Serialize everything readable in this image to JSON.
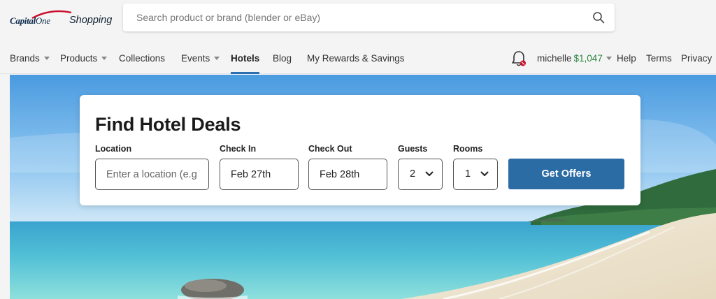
{
  "logo": {
    "brand_word": "Capital",
    "brand_one": "One",
    "product": "Shopping"
  },
  "search": {
    "placeholder": "Search product or brand (blender or eBay)",
    "icon": "search-icon"
  },
  "nav": {
    "items": [
      {
        "label": "Brands",
        "dropdown": true
      },
      {
        "label": "Products",
        "dropdown": true
      },
      {
        "label": "Collections",
        "dropdown": false
      },
      {
        "label": "Events",
        "dropdown": true
      },
      {
        "label": "Hotels",
        "dropdown": false,
        "active": true
      },
      {
        "label": "Blog",
        "dropdown": false
      },
      {
        "label": "My Rewards & Savings",
        "dropdown": false
      }
    ],
    "right": {
      "notification_icon": "bell-icon",
      "username": "michelle",
      "balance": "$1,047",
      "links": [
        "Help",
        "Terms",
        "Privacy"
      ]
    }
  },
  "hotel_form": {
    "title": "Find Hotel Deals",
    "location": {
      "label": "Location",
      "placeholder": "Enter a location (e.g"
    },
    "check_in": {
      "label": "Check In",
      "value": "Feb 27th"
    },
    "check_out": {
      "label": "Check Out",
      "value": "Feb 28th"
    },
    "guests": {
      "label": "Guests",
      "value": "2"
    },
    "rooms": {
      "label": "Rooms",
      "value": "1"
    },
    "submit_label": "Get Offers"
  },
  "colors": {
    "accent": "#2b6ca4",
    "balance": "#2e8540",
    "active_underline": "#2a6fb0"
  }
}
